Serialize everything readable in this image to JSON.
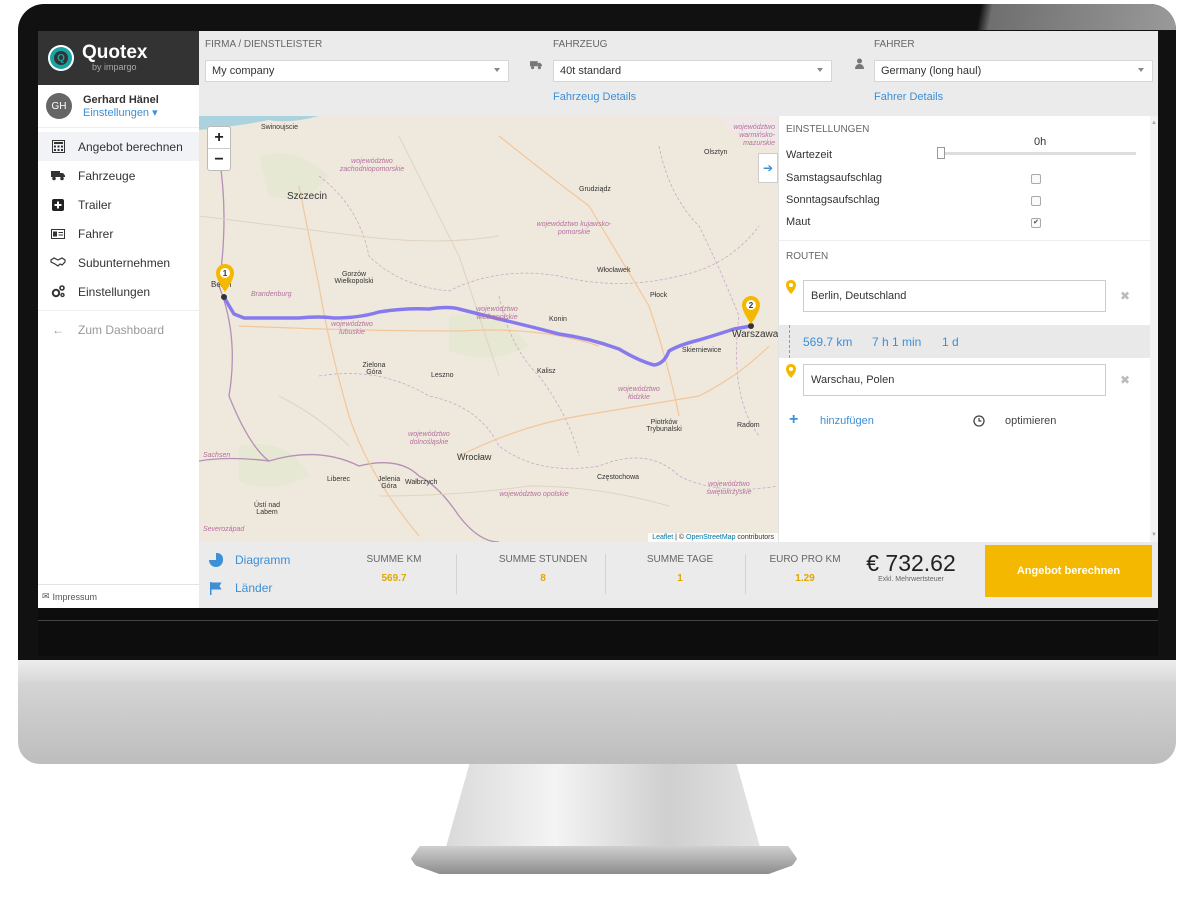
{
  "brand": {
    "name": "Quotex",
    "sub": "by impargo"
  },
  "user": {
    "initials": "GH",
    "name": "Gerhard Hänel",
    "settings": "Einstellungen ▾"
  },
  "nav": [
    {
      "label": "Angebot berechnen",
      "icon": "calculator-icon"
    },
    {
      "label": "Fahrzeuge",
      "icon": "truck-icon"
    },
    {
      "label": "Trailer",
      "icon": "trailer-plus-icon"
    },
    {
      "label": "Fahrer",
      "icon": "id-card-icon"
    },
    {
      "label": "Subunternehmen",
      "icon": "handshake-icon"
    },
    {
      "label": "Einstellungen",
      "icon": "gears-icon"
    }
  ],
  "back": {
    "label": "Zum Dashboard"
  },
  "impressum": "Impressum",
  "topbar": {
    "company": {
      "label": "FIRMA / DIENSTLEISTER",
      "value": "My company"
    },
    "vehicle": {
      "label": "FAHRZEUG",
      "value": "40t standard",
      "details": "Fahrzeug Details"
    },
    "driver": {
      "label": "FAHRER",
      "value": "Germany (long haul)",
      "details": "Fahrer Details"
    }
  },
  "map": {
    "zoom_in": "+",
    "zoom_out": "−",
    "attribution_leaflet": "Leaflet",
    "attribution_rest": "| © ",
    "attribution_osm": "OpenStreetMap",
    "attribution_contrib": "contributors",
    "markers": [
      "1",
      "2"
    ],
    "cities": [
      "Swinoujscie",
      "Szczecin",
      "Olsztyn",
      "Grudziądz",
      "Włocławek",
      "Płock",
      "Gorzów Wielkopolski",
      "Berlin",
      "Konin",
      "Warszawa",
      "Skierniewice",
      "Zielona Góra",
      "Leszno",
      "Kalisz",
      "Piotrków Trybunalski",
      "Radom",
      "Wrocław",
      "Liberec",
      "Jelenia Góra",
      "Wałbrzych",
      "Częstochowa",
      "Ústí nad Labem"
    ],
    "regions": [
      "województwo zachodniopomorskie",
      "województwo kujawsko-pomorskie",
      "Brandenburg",
      "województwo lubuskie",
      "województwo wielkopolskie",
      "województwo łódzkie",
      "województwo dolnośląskie",
      "województwo opolskie",
      "województwo świętokrzyskie",
      "Sachsen",
      "Severozápad",
      "województwo warmińsko-mazurskie"
    ],
    "route_color": "#7b6ef0",
    "marker_color": "#f5b800"
  },
  "settings": {
    "title": "EINSTELLUNGEN",
    "wait_label": "Wartezeit",
    "wait_value": "0h",
    "saturday": "Samstagsaufschlag",
    "sunday": "Sonntagsaufschlag",
    "toll": "Maut",
    "toll_checked": "✔"
  },
  "routes": {
    "title": "ROUTEN",
    "from": "Berlin, Deutschland",
    "to": "Warschau, Polen",
    "distance": "569.7 km",
    "duration": "7 h 1 min",
    "days": "1 d",
    "add": "hinzufügen",
    "optimize": "optimieren",
    "remove": "✖"
  },
  "bottom": {
    "diagram": "Diagramm",
    "countries": "Länder",
    "stats": [
      {
        "label": "SUMME KM",
        "value": "569.7"
      },
      {
        "label": "SUMME STUNDEN",
        "value": "8"
      },
      {
        "label": "SUMME TAGE",
        "value": "1"
      },
      {
        "label": "EURO PRO KM",
        "value": "1.29"
      }
    ],
    "price": "€ 732.62",
    "price_note": "Exkl. Mehrwertsteuer",
    "cta": "Angebot berechnen"
  },
  "colors": {
    "accent": "#3d8fd6",
    "brand_dark": "#333333",
    "cta": "#f5b800"
  }
}
